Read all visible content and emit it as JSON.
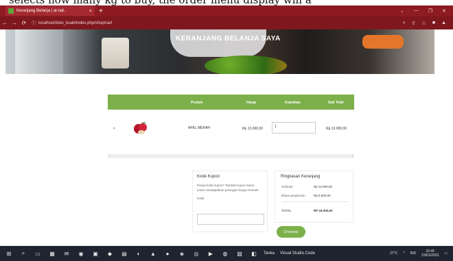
{
  "caption": "selects how many kg to buy, the order menu display will a",
  "browser": {
    "tab_title": "Keranjang Belanja | al-nat..",
    "tab_close": "×",
    "new_tab": "+",
    "url": "localhost/toko_buah/index.php/shop/cart",
    "window_controls": [
      "⌄",
      "—",
      "❐",
      "✕"
    ]
  },
  "hero": {
    "title": "KERANJANG BELANJA SAYA"
  },
  "table": {
    "headers": [
      "Produk",
      "Harga",
      "Kuantitas",
      "Sub Total"
    ],
    "rows": [
      {
        "remove": "×",
        "name": "APEL MERAH",
        "price": "Rp 13.000,00",
        "qty": "1",
        "subtotal": "Rp 13.000,00"
      }
    ],
    "scroll_left": "‹",
    "scroll_right": "›"
  },
  "coupon": {
    "title": "Kode Kupon",
    "description": "Punya kode kupon? Tambah kupon Kamu untuk mendapatkan potongan harga menarik",
    "label": "Kode",
    "placeholder": ""
  },
  "summary": {
    "title": "Ringkasan Keranjang",
    "rows": [
      {
        "label": "Subtotal",
        "value": "Rp 13.000,00"
      },
      {
        "label": "Biaya pengiriman",
        "value": "Rp 5.000,00"
      }
    ],
    "total_label": "TOTAL",
    "total_value": "RP 18.000,00"
  },
  "checkout_label": "Checkout",
  "taskbar": {
    "apps": [
      "⊞",
      "⌕",
      "▭",
      "▦",
      "✉",
      "◉",
      "▣",
      "◆",
      "▤",
      "◐",
      "▲",
      "●",
      "◈",
      "◎",
      "▶",
      "◍",
      "▧",
      "◧"
    ],
    "active_items": [
      "Tanka",
      "Visual Studio Code"
    ],
    "weather": "27°C",
    "lang": "IND",
    "time": "15:45",
    "date": "23/01/2023"
  },
  "colors": {
    "accent": "#7cb04a",
    "browser": "#8e1b22",
    "taskbar": "#1f2430"
  }
}
